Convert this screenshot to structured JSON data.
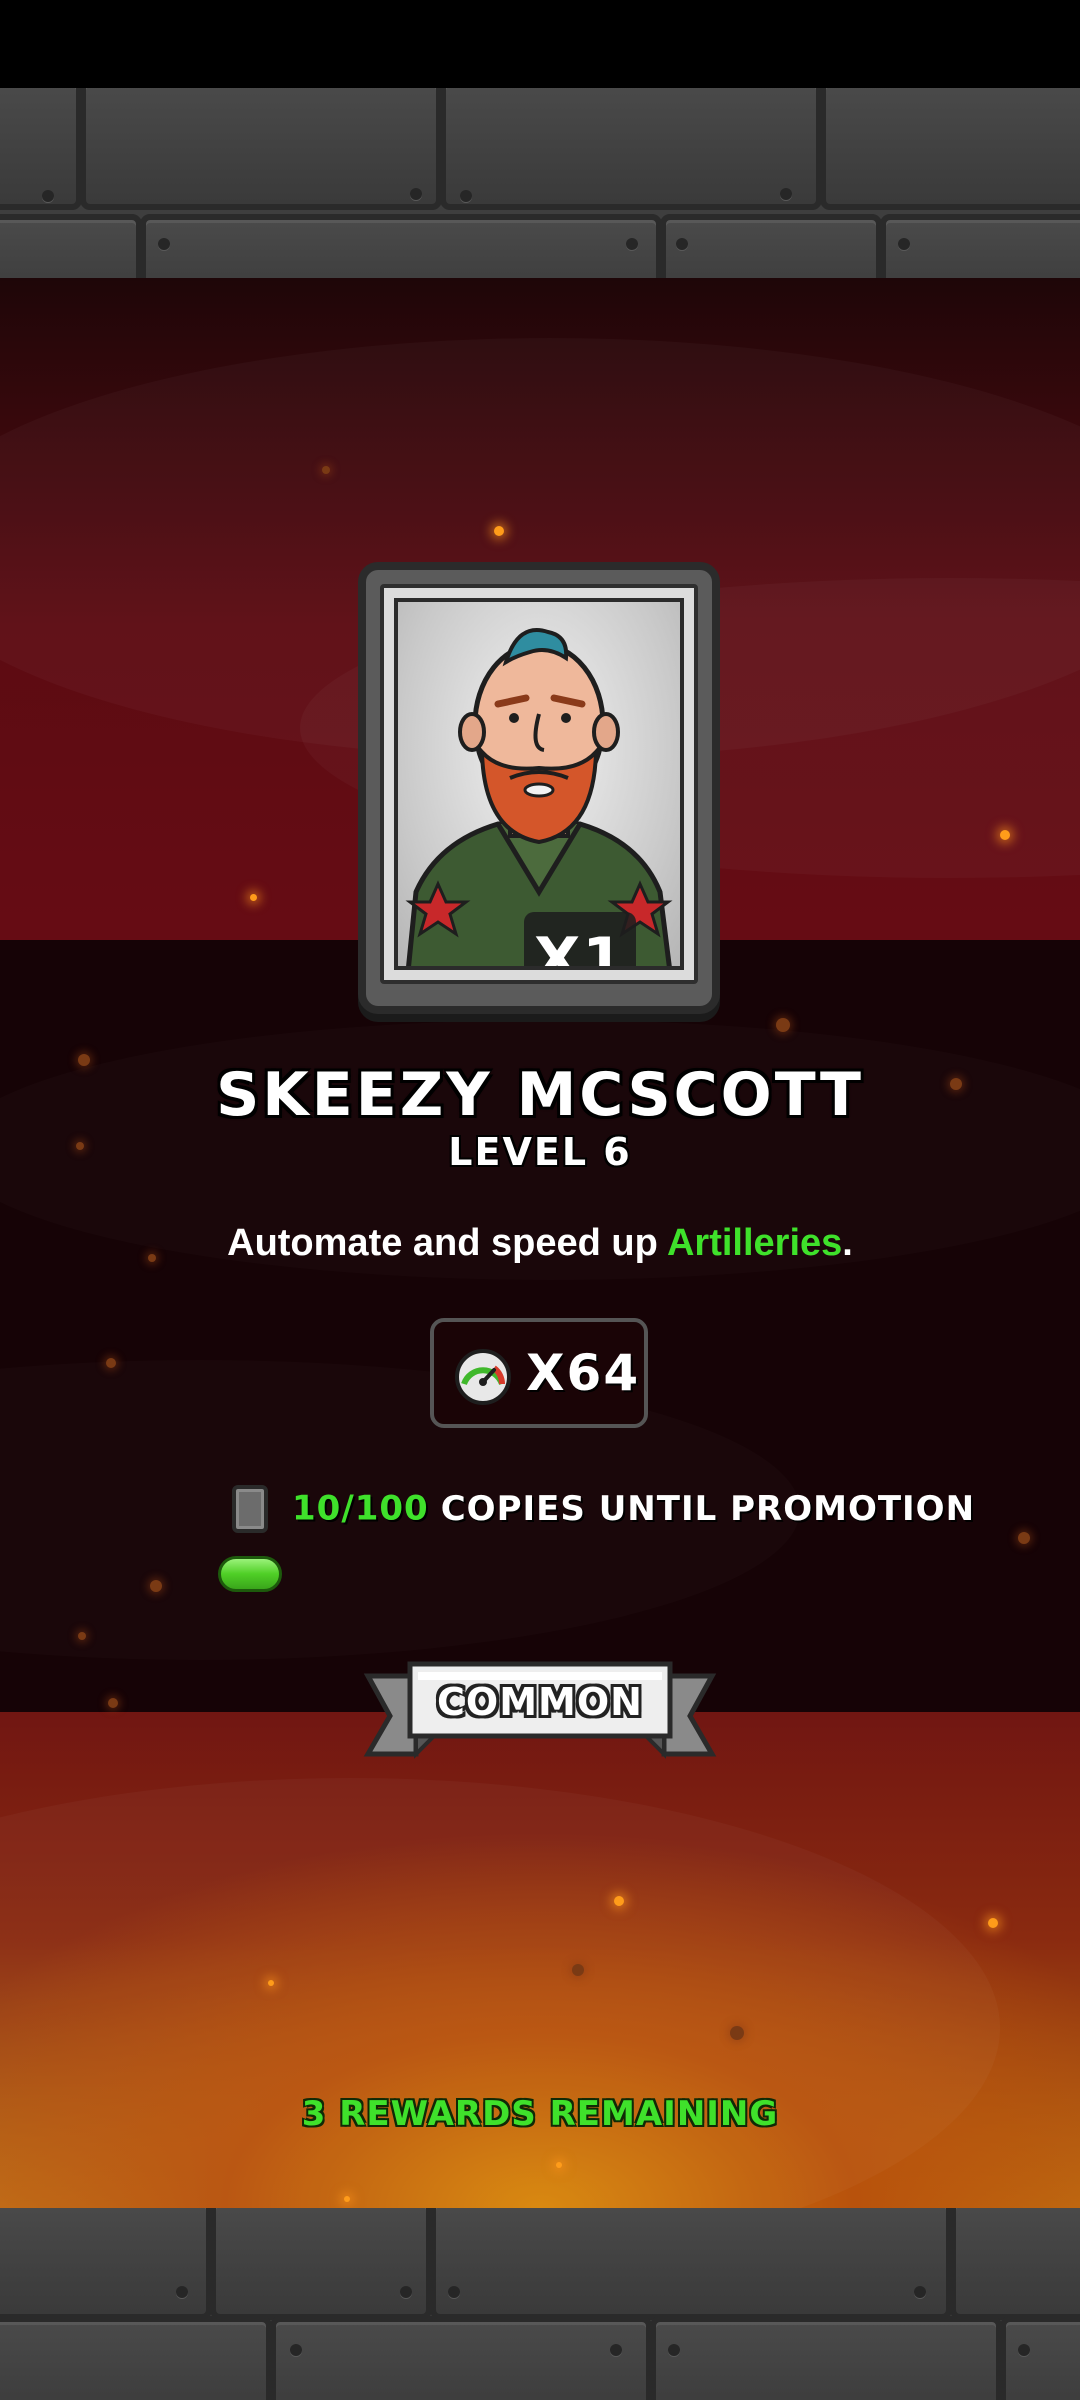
{
  "hero": {
    "copies_badge": "X1",
    "name": "SKEEZY MCSCOTT",
    "level": "LEVEL 6"
  },
  "description": {
    "prefix": "Automate and speed up ",
    "highlight": "Artilleries",
    "suffix": "."
  },
  "speed_boost": {
    "icon": "speedometer-icon",
    "value": "X64"
  },
  "promotion": {
    "icon": "card-icon",
    "count": "10/100",
    "text": "COPIES UNTIL PROMOTION",
    "progress_fraction": 0.1
  },
  "rarity": {
    "label": "COMMON"
  },
  "footer": {
    "rewards_remaining": "3 REWARDS REMAINING"
  },
  "colors": {
    "accent_green": "#3fe12b",
    "panel_red": "#6a0d15",
    "panel_orange": "#c27312"
  }
}
